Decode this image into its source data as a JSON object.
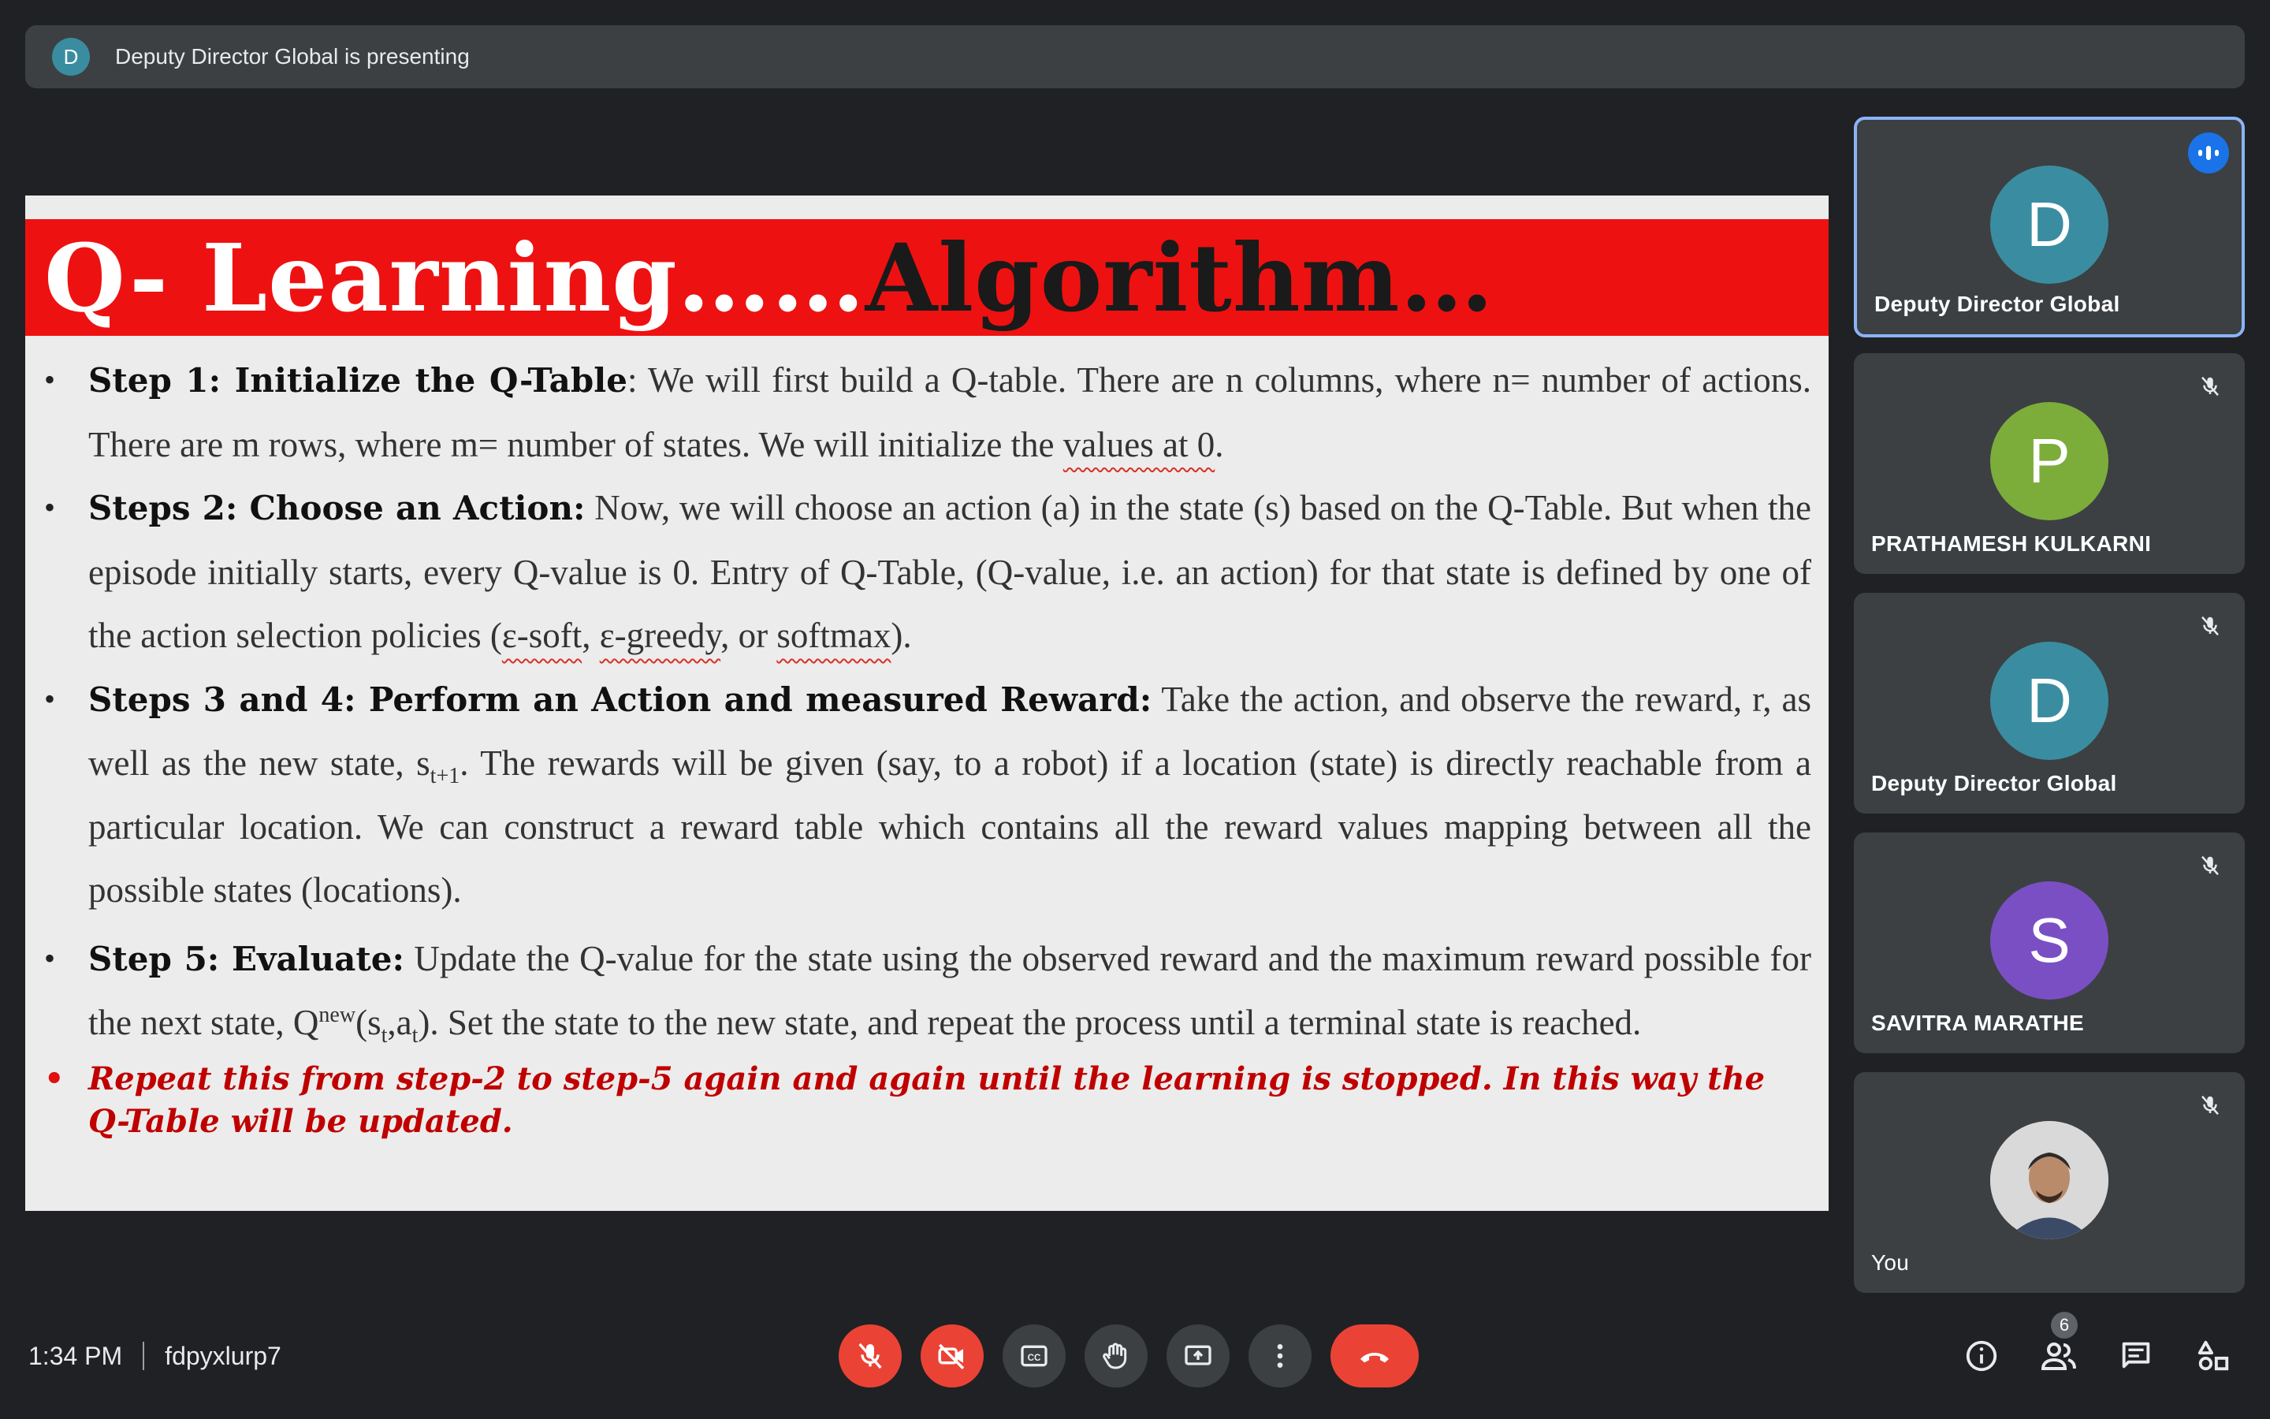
{
  "header": {
    "presenter_initial": "D",
    "presenting_text": "Deputy Director Global is presenting"
  },
  "slide": {
    "title_white": "Q- Learning……",
    "title_black": "Algorithm…",
    "step1": {
      "label": "Step 1: Initialize the Q-Table",
      "text_a": ": We will first build a Q-table. There are n columns, where n= number of actions. There are m rows, where m= number of states. We will initialize the ",
      "underlined": "values at 0",
      "text_b": "."
    },
    "step2": {
      "label": "Steps 2: Choose an Action:",
      "text_a": " Now, we will choose an action (a) in the state (s) based on the Q-Table. But when the episode initially starts, every Q-value is 0. Entry of Q-Table, (Q-value, i.e. an action) for that state is defined by one of the action selection policies ",
      "paren_open": "(",
      "policy1": "ε-soft",
      "sep1": ", ",
      "policy2": "ε-greedy",
      "sep2": ", or ",
      "policy3": "softmax",
      "text_b": ")."
    },
    "step34": {
      "label": "Steps 3 and 4: Perform an Action and measured Reward:",
      "text_a": " Take the action, and observe the reward, r, as well as the new state, s",
      "sub": "t+1",
      "text_b": ". The rewards will be given (say, to a robot) if a location (state) is directly reachable from a particular location. We can construct a reward table which contains all the reward values mapping between all the possible states (locations)."
    },
    "step5": {
      "label": "Step 5: Evaluate:",
      "text_a": " Update the Q-value for the state using the observed reward and the maximum reward possible for the next state, Q",
      "sup": "new",
      "text_b": "(s",
      "sub1": "t",
      "text_c": ",a",
      "sub2": "t",
      "text_d": "). Set the state to the new state, and repeat the process until a terminal state is reached."
    },
    "repeat_note": "Repeat this from step-2 to step-5 again and again until the learning is stopped. In this way the Q-Table will be updated."
  },
  "participants": [
    {
      "initial": "D",
      "name": "Deputy Director Global",
      "color": "#3a8da0",
      "speaking": true
    },
    {
      "initial": "P",
      "name": "PRATHAMESH KULKARNI",
      "color": "#7cad3b",
      "muted": true
    },
    {
      "initial": "D",
      "name": "Deputy Director Global",
      "color": "#3a8da0",
      "muted": true
    },
    {
      "initial": "S",
      "name": "SAVITRA MARATHE",
      "color": "#7b4fc4",
      "muted": true
    },
    {
      "name": "You",
      "muted": true
    }
  ],
  "footer": {
    "time": "1:34 PM",
    "meeting_code": "fdpyxlurp7",
    "people_count": "6"
  },
  "colors": {
    "background": "#202124",
    "tile": "#3c4043",
    "danger": "#ea4335",
    "active_border": "#8ab4f8",
    "slide_banner": "#ee1111"
  },
  "icons": [
    "mic-off-icon",
    "camera-off-icon",
    "captions-icon",
    "raise-hand-icon",
    "present-screen-icon",
    "more-options-icon",
    "end-call-icon",
    "info-icon",
    "people-icon",
    "chat-icon",
    "activities-icon"
  ]
}
